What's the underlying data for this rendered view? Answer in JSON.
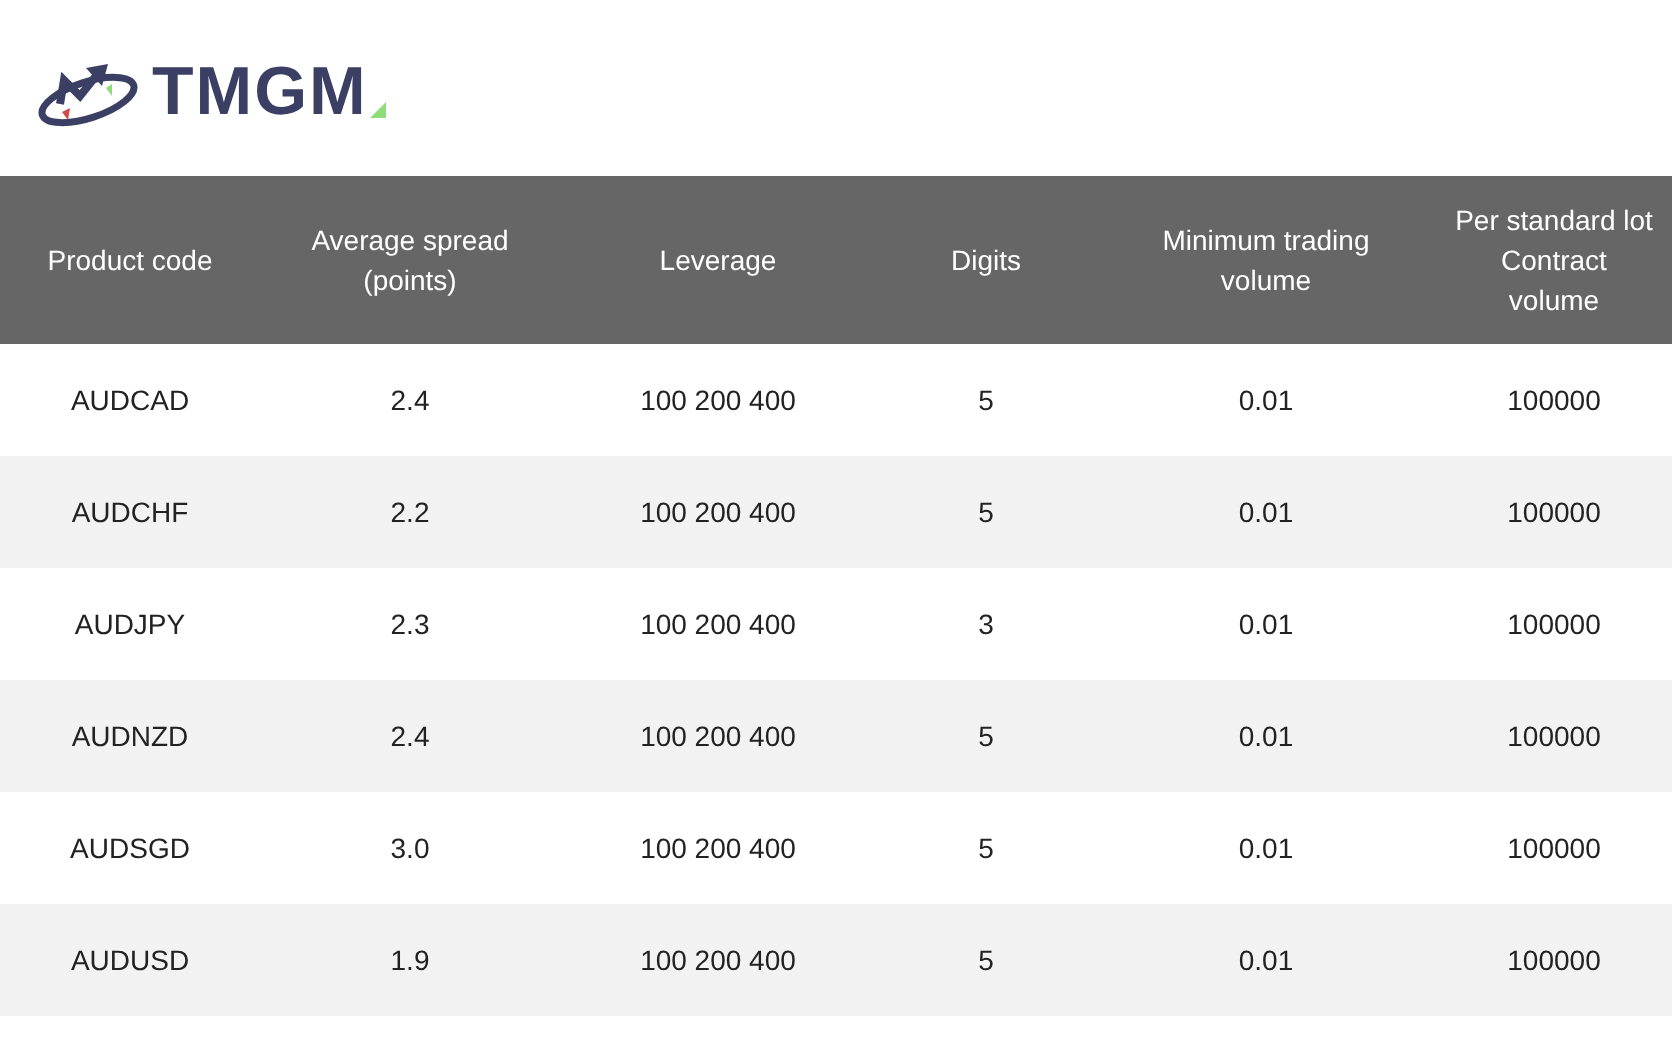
{
  "logo": {
    "text": "TMGM"
  },
  "table": {
    "columns": [
      "Product code",
      "Average spread\n(points)",
      "Leverage",
      "Digits",
      "Minimum trading\nvolume",
      "Per standard lot\nContract\nvolume"
    ],
    "rows": [
      [
        "AUDCAD",
        "2.4",
        "100 200 400",
        "5",
        "0.01",
        "100000"
      ],
      [
        "AUDCHF",
        "2.2",
        "100 200 400",
        "5",
        "0.01",
        "100000"
      ],
      [
        "AUDJPY",
        "2.3",
        "100 200 400",
        "3",
        "0.01",
        "100000"
      ],
      [
        "AUDNZD",
        "2.4",
        "100 200 400",
        "5",
        "0.01",
        "100000"
      ],
      [
        "AUDSGD",
        "3.0",
        "100 200 400",
        "5",
        "0.01",
        "100000"
      ],
      [
        "AUDUSD",
        "1.9",
        "100 200 400",
        "5",
        "0.01",
        "100000"
      ]
    ]
  }
}
